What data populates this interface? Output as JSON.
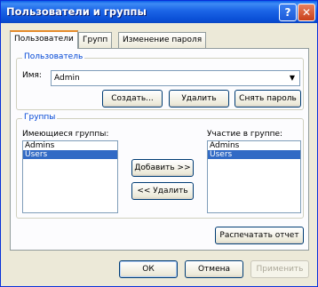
{
  "window": {
    "title": "Пользователи и группы",
    "help_symbol": "?",
    "close_symbol": "✕"
  },
  "tabs": [
    {
      "label": "Пользователи"
    },
    {
      "label": "Групп"
    },
    {
      "label": "Изменение пароля"
    }
  ],
  "user_group": {
    "title": "Пользователь",
    "name_label": "Имя:",
    "name_value": "Admin",
    "create_button": "Создать...",
    "delete_button": "Удалить",
    "clear_password_button": "Снять пароль"
  },
  "groups_group": {
    "title": "Группы",
    "available_label": "Имеющиеся группы:",
    "available": [
      "Admins",
      "Users"
    ],
    "member_label": "Участие в группе:",
    "member": [
      "Admins",
      "Users"
    ],
    "add_button": "Добавить >>",
    "remove_button": "<< Удалить"
  },
  "print_report_button": "Распечатать отчет",
  "footer": {
    "ok": "ОК",
    "cancel": "Отмена",
    "apply": "Применить"
  }
}
